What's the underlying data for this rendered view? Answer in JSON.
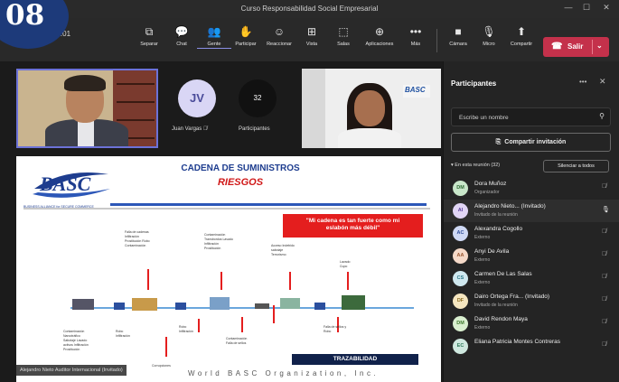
{
  "window": {
    "title": "Curso Responsabilidad Social Empresarial",
    "controls": [
      "—",
      "☐",
      "✕"
    ]
  },
  "badge": "08",
  "toolbar": {
    "meeting_time": "18:01",
    "items": [
      {
        "label": "Separar",
        "icon": "⧉"
      },
      {
        "label": "Chat",
        "icon": "💬"
      },
      {
        "label": "Gente",
        "icon": "👥"
      },
      {
        "label": "Participar",
        "icon": "✋"
      },
      {
        "label": "Reaccionar",
        "icon": "☺"
      },
      {
        "label": "Vista",
        "icon": "⊞"
      },
      {
        "label": "Salas",
        "icon": "⬚"
      },
      {
        "label": "Aplicaciones",
        "icon": "⊕"
      },
      {
        "label": "Más",
        "icon": "•••"
      },
      {
        "label": "Cámara",
        "icon": "■"
      },
      {
        "label": "Micro",
        "icon": "🎙"
      },
      {
        "label": "Compartir",
        "icon": "⬆"
      }
    ],
    "leave_label": "Salir",
    "accent": "#c4314b"
  },
  "tiles": {
    "jv_initials": "JV",
    "jv_name": "Juan Vargas",
    "participants_count": "32",
    "participants_label": "Participantes"
  },
  "slide": {
    "brand": "BASC",
    "brand_sub": "BUSINESS ALLIANCE for SECURE COMMERCE",
    "title": "CADENA DE SUMINISTROS",
    "subtitle": "RIESGOS",
    "quote_line1": "\"Mi cadena es tan fuerte como mi",
    "quote_line2": "eslabón más  débil\"",
    "badge_text": "TRAZABILIDAD",
    "footer": "World BASC Organization, Inc.",
    "speaker_label": "Alejandro Nieto Auditor Internacional (Invitado)"
  },
  "panel": {
    "title": "Participantes",
    "search_placeholder": "Escribe un nombre",
    "share_label": "Compartir invitación",
    "section_label": "En esta reunión (32)",
    "mute_all_label": "Silenciar a todos",
    "people": [
      {
        "initials": "DM",
        "name": "Dora Muñoz",
        "role": "Organizador",
        "bg": "#c8e6c9",
        "fg": "#2e6b34"
      },
      {
        "initials": "AI",
        "name": "Alejandro Nieto... (Invitado)",
        "role": "Invitado de la reunión",
        "bg": "#e1d5f5",
        "fg": "#5a3f99"
      },
      {
        "initials": "AC",
        "name": "Alexandra Cogollo",
        "role": "Externo",
        "bg": "#cfd9f5",
        "fg": "#2f4d99"
      },
      {
        "initials": "AA",
        "name": "Anyi De Avila",
        "role": "Externo",
        "bg": "#f5d9c8",
        "fg": "#99552f"
      },
      {
        "initials": "CS",
        "name": "Carmen De Las Salas",
        "role": "Externo",
        "bg": "#cfe8ef",
        "fg": "#2f7a8a"
      },
      {
        "initials": "DF",
        "name": "Dairo Ortega Fra... (Invitado)",
        "role": "Invitado de la reunión",
        "bg": "#f5e6c0",
        "fg": "#8a6a1f"
      },
      {
        "initials": "DM",
        "name": "David Rendon Maya",
        "role": "Externo",
        "bg": "#d9efcf",
        "fg": "#3f7a2f"
      },
      {
        "initials": "EC",
        "name": "Eliana Patricia Montes Contreras",
        "role": "",
        "bg": "#cfe8df",
        "fg": "#2f7a5a"
      }
    ]
  }
}
